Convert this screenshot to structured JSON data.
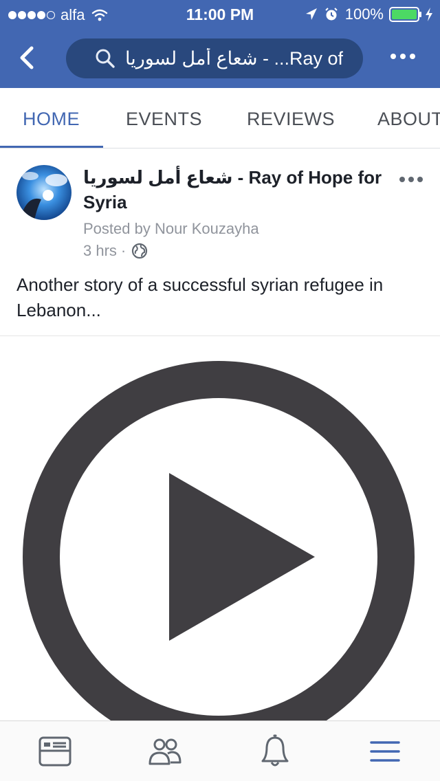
{
  "status_bar": {
    "carrier": "alfa",
    "time": "11:00 PM",
    "battery": "100%"
  },
  "header": {
    "search_text": "شعاع أمل لسوريا - ...Ray of"
  },
  "tabs": [
    {
      "label": "HOME",
      "active": true
    },
    {
      "label": "EVENTS",
      "active": false
    },
    {
      "label": "REVIEWS",
      "active": false
    },
    {
      "label": "ABOUT",
      "active": false
    }
  ],
  "post": {
    "page_name": "شعاع أمل لسوريا - Ray of Hope for Syria",
    "posted_by": "Posted by Nour Kouzayha",
    "time_ago": "3 hrs",
    "separator": "·",
    "text": "Another story of a successful syrian refugee in Lebanon..."
  },
  "colors": {
    "brand_blue": "#4267b2",
    "search_bg": "#29487d",
    "play_icon": "#403e42"
  },
  "icons": {
    "back": "chevron-left-icon",
    "search": "search-icon",
    "more": "more-dots-icon",
    "globe": "globe-icon",
    "play": "play-icon",
    "bottom_nav": [
      "news-feed-icon",
      "friends-icon",
      "notifications-bell-icon",
      "menu-icon"
    ]
  }
}
